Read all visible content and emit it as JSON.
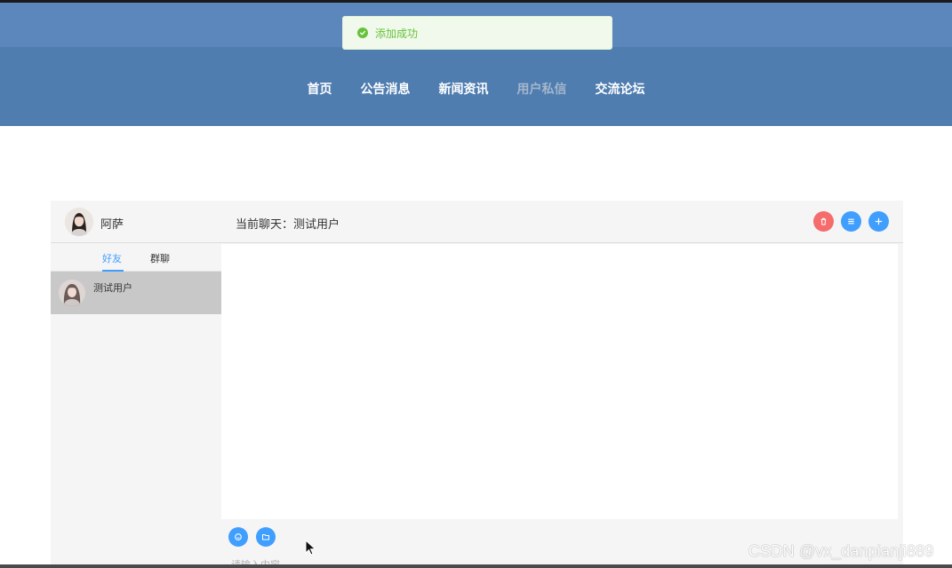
{
  "toast": {
    "text": "添加成功",
    "color": "#67c23a"
  },
  "nav": {
    "items": [
      {
        "label": "首页",
        "active": false
      },
      {
        "label": "公告消息",
        "active": false
      },
      {
        "label": "新闻资讯",
        "active": false
      },
      {
        "label": "用户私信",
        "active": true
      },
      {
        "label": "交流论坛",
        "active": false
      }
    ]
  },
  "chat": {
    "me_name": "阿萨",
    "title_prefix": "当前聊天：",
    "title_user": "测试用户",
    "tabs": [
      {
        "label": "好友",
        "active": true
      },
      {
        "label": "群聊",
        "active": false
      }
    ],
    "contacts": [
      {
        "name": "测试用户",
        "selected": true
      }
    ],
    "input_placeholder": "请输入内容"
  },
  "watermark": "CSDN @vx_danpianji889",
  "colors": {
    "header": "#4f7db0",
    "primary": "#409eff",
    "danger": "#f56c6c",
    "panel": "#f5f5f5"
  },
  "icons": {
    "toast": "check-circle-icon",
    "delete": "trash-icon",
    "list": "list-icon",
    "add": "plus-icon",
    "emoji": "emoji-icon",
    "file": "folder-icon"
  }
}
